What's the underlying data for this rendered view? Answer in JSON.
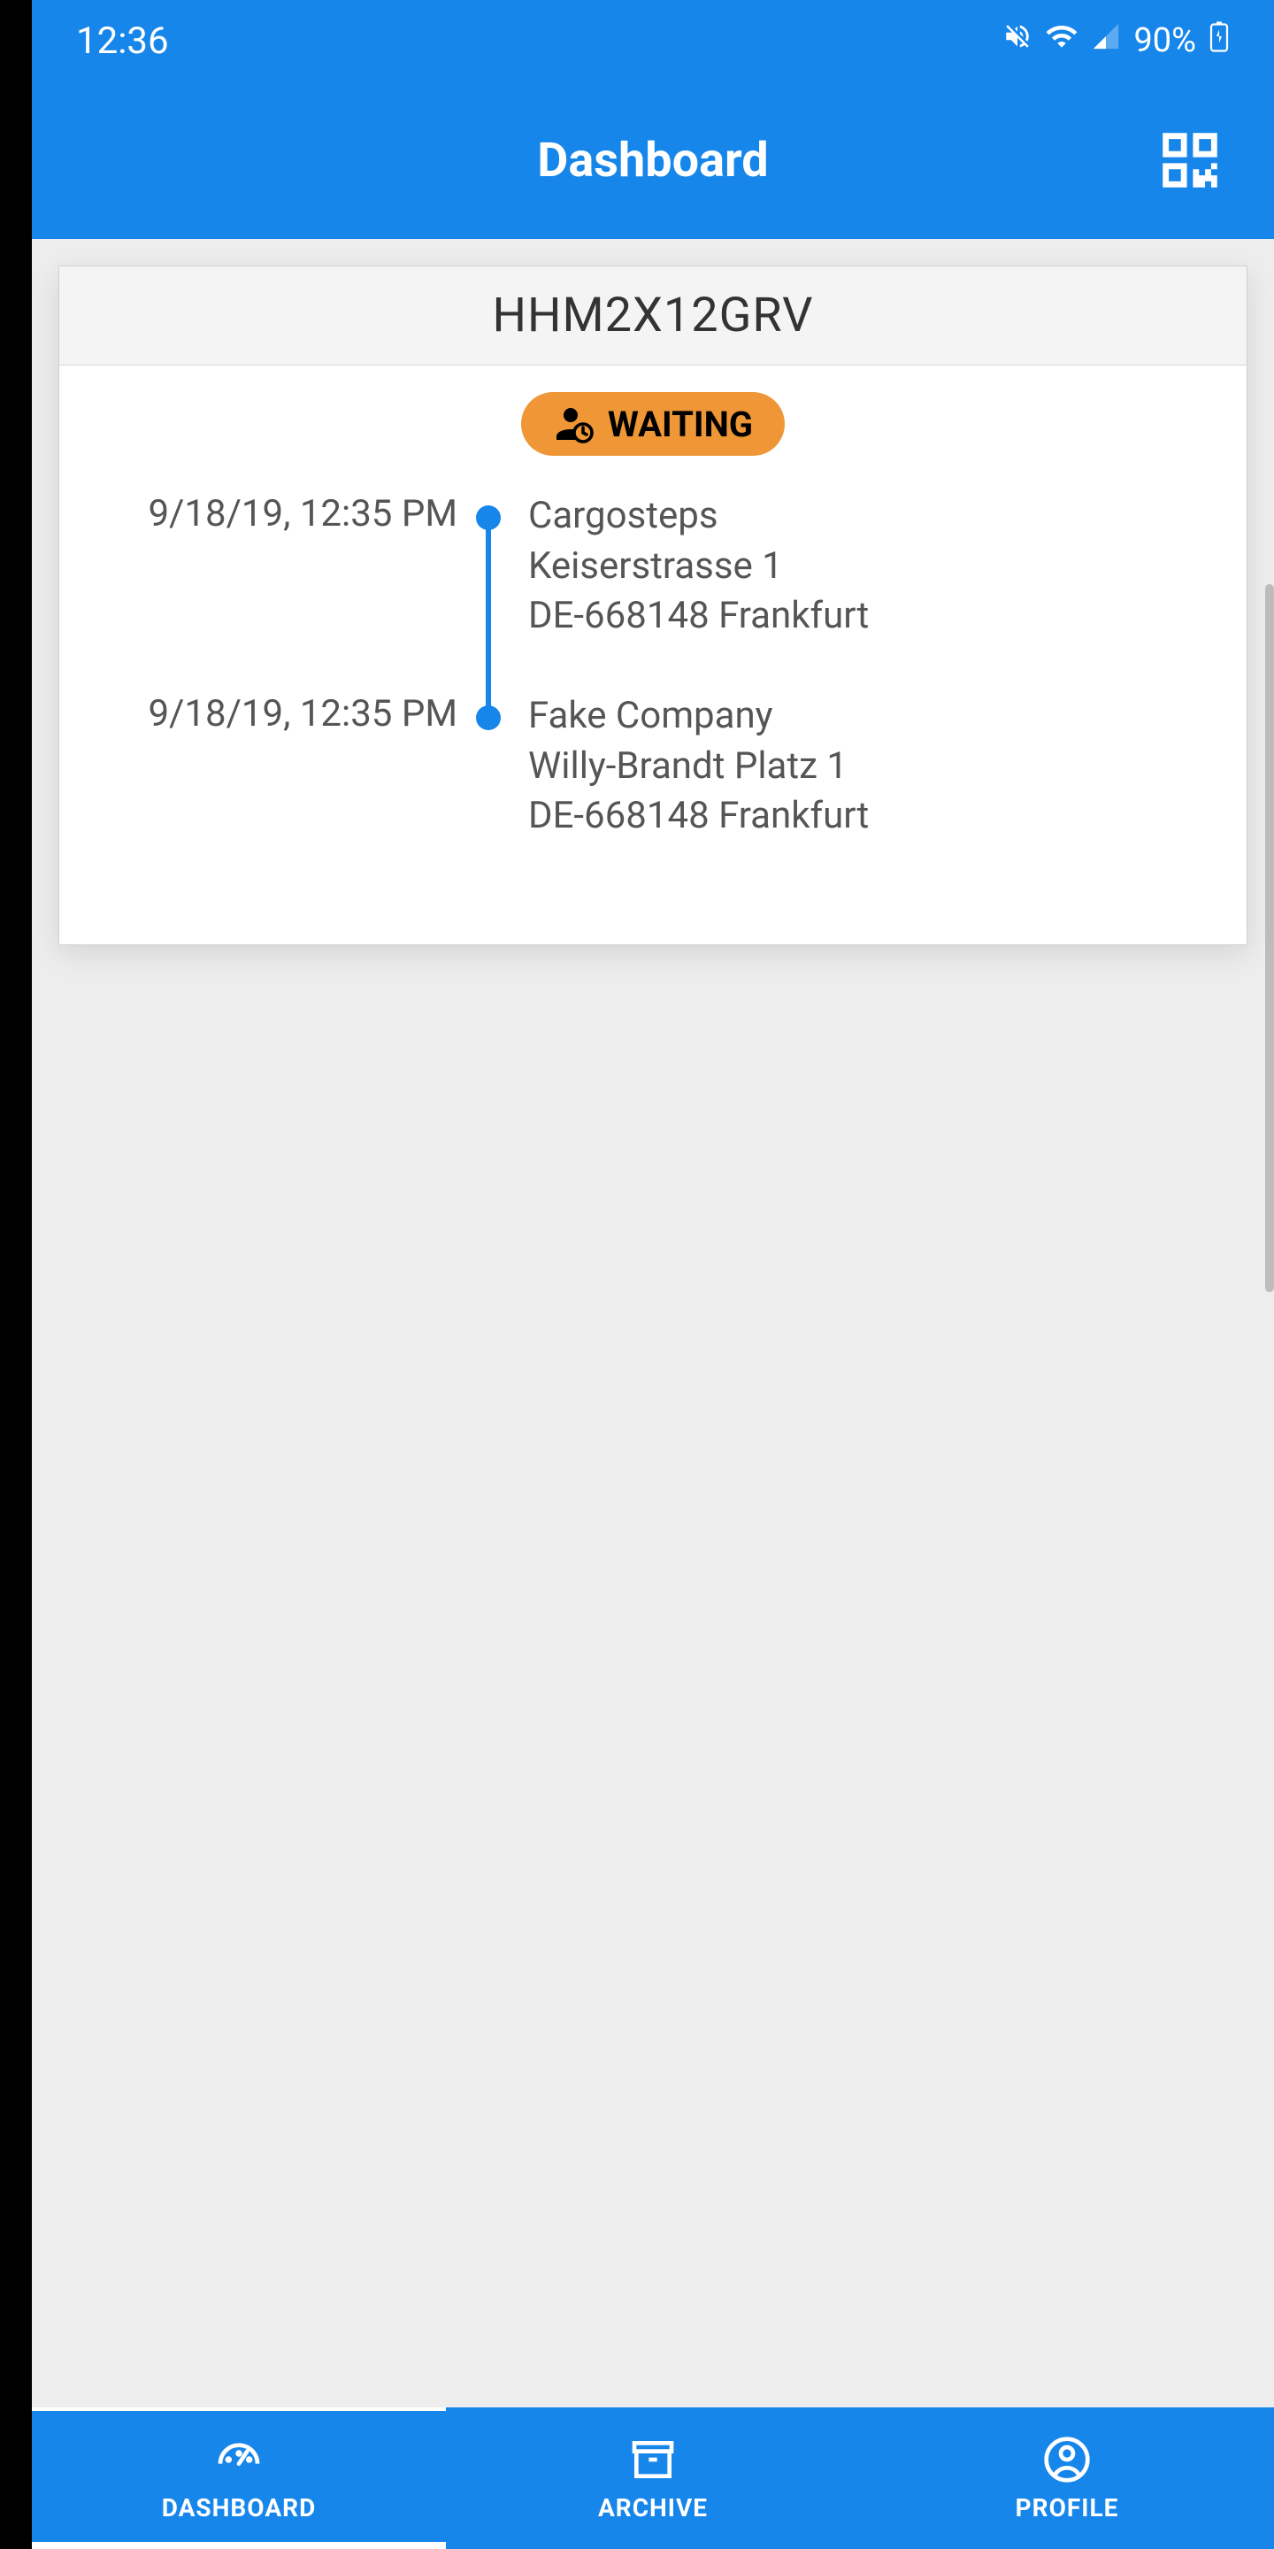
{
  "statusBar": {
    "time": "12:36",
    "battery": "90%"
  },
  "header": {
    "title": "Dashboard"
  },
  "card": {
    "trackingCode": "HHM2X12GRV",
    "status": "WAITING",
    "stops": [
      {
        "time": "9/18/19, 12:35 PM",
        "company": "Cargosteps",
        "street": "Keiserstrasse 1",
        "city": "DE-668148 Frankfurt"
      },
      {
        "time": "9/18/19, 12:35 PM",
        "company": "Fake Company",
        "street": "Willy-Brandt Platz 1",
        "city": "DE-668148 Frankfurt"
      }
    ]
  },
  "nav": {
    "dashboard": "DASHBOARD",
    "archive": "ARCHIVE",
    "profile": "PROFILE"
  }
}
